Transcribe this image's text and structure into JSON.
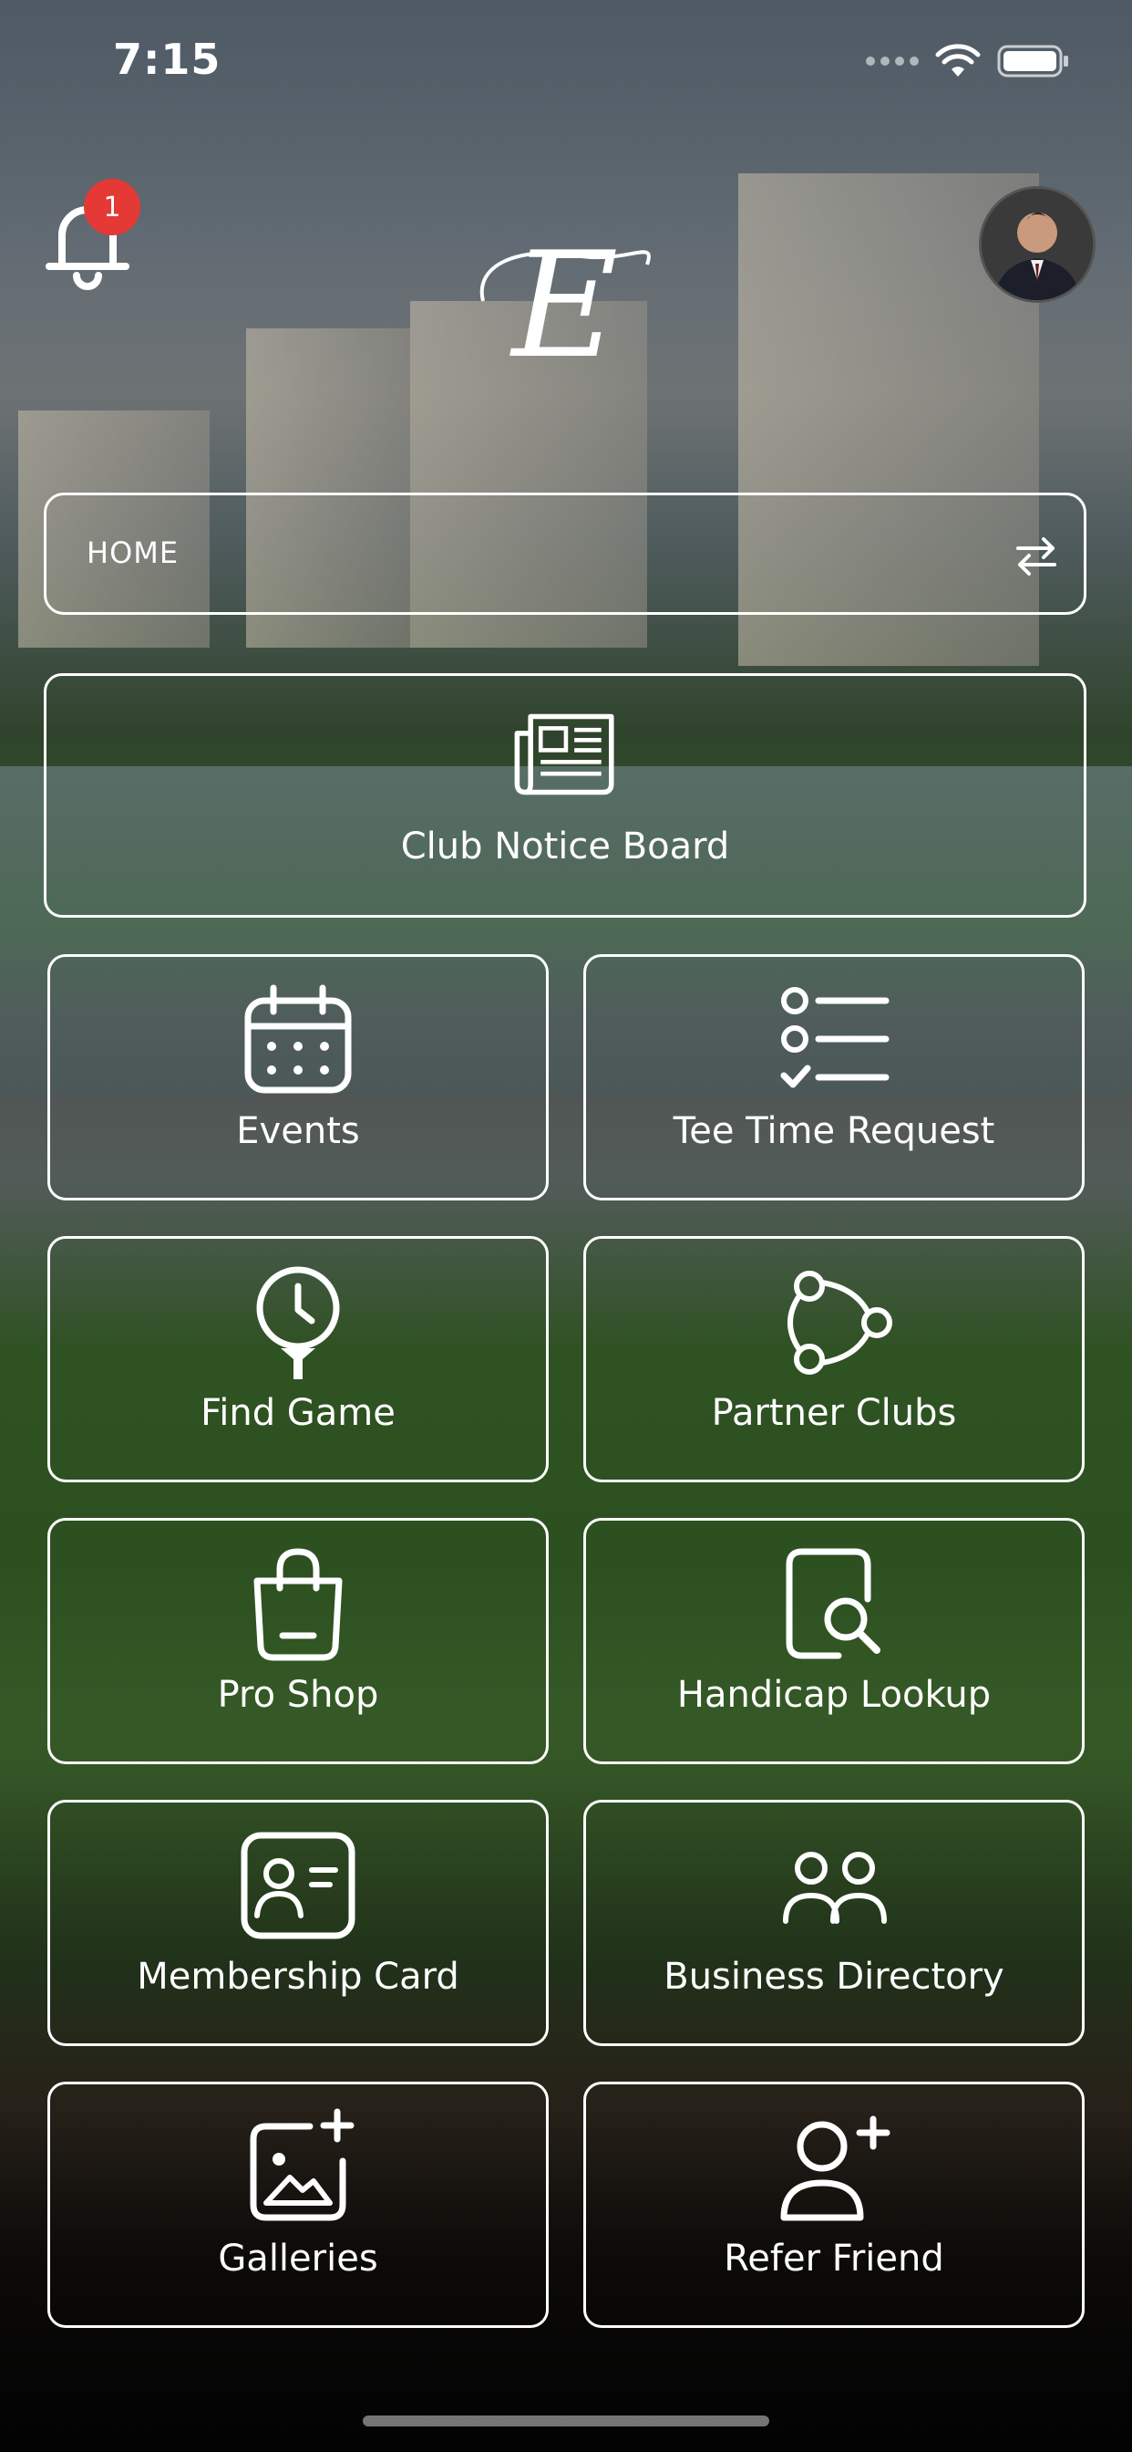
{
  "status_bar": {
    "time": "7:15"
  },
  "notifications": {
    "count": "1"
  },
  "logo": {
    "letter": "E"
  },
  "home_bar": {
    "label": "HOME"
  },
  "tiles": {
    "notice_board": "Club Notice Board",
    "events": "Events",
    "tee_time": "Tee Time Request",
    "find_game": "Find Game",
    "partner_clubs": "Partner Clubs",
    "pro_shop": "Pro Shop",
    "handicap_lookup": "Handicap Lookup",
    "membership_card": "Membership Card",
    "business_directory": "Business Directory",
    "galleries": "Galleries",
    "refer_friend": "Refer Friend"
  }
}
